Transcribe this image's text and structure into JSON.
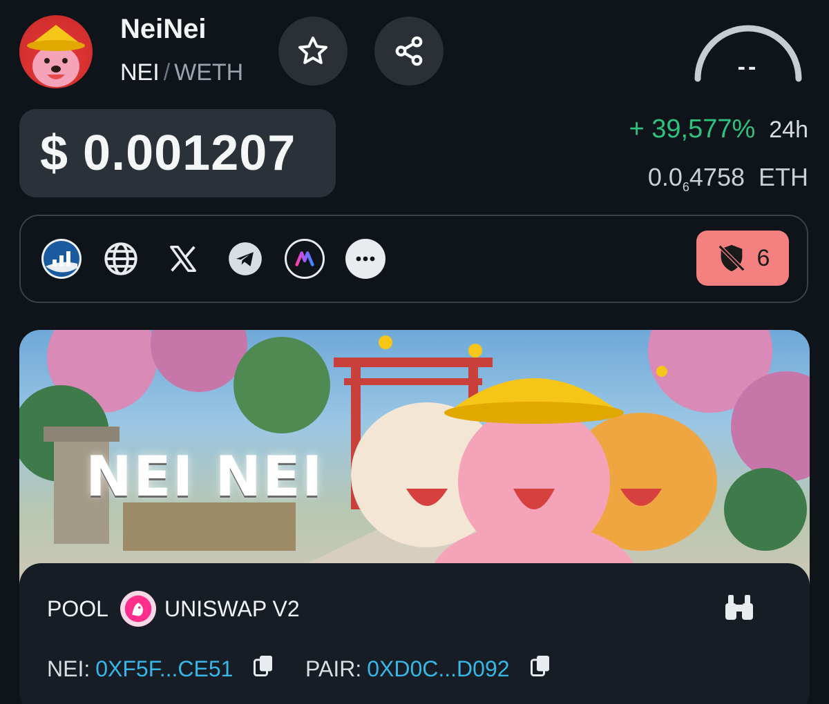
{
  "header": {
    "token_name": "NeiNei",
    "base_symbol": "NEI",
    "separator": "/",
    "quote_symbol": "WETH",
    "gauge_value": "--",
    "icons": [
      "star-icon",
      "share-icon"
    ]
  },
  "price": {
    "usd": "$ 0.001207",
    "change_24h": "+ 39,577%",
    "change_period": "24h",
    "eth_prefix": "0.0",
    "eth_zero_count": "6",
    "eth_suffix": "4758",
    "eth_unit": "ETH"
  },
  "links": {
    "items": [
      "coin-tracker-icon",
      "globe-icon",
      "x-icon",
      "telegram-icon",
      "multichain-icon",
      "more-icon"
    ],
    "audit_count": "6",
    "audit_color": "#f48080"
  },
  "banner": {
    "title": "NEI NEI"
  },
  "pool": {
    "label": "POOL",
    "dex": "UNISWAP V2",
    "token_key": "NEI:",
    "token_address": "0XF5F...CE51",
    "pair_key": "PAIR:",
    "pair_address": "0XD0C...D092"
  },
  "colors": {
    "background": "#0e141a",
    "positive": "#2ec27e",
    "address": "#38b6e8"
  }
}
